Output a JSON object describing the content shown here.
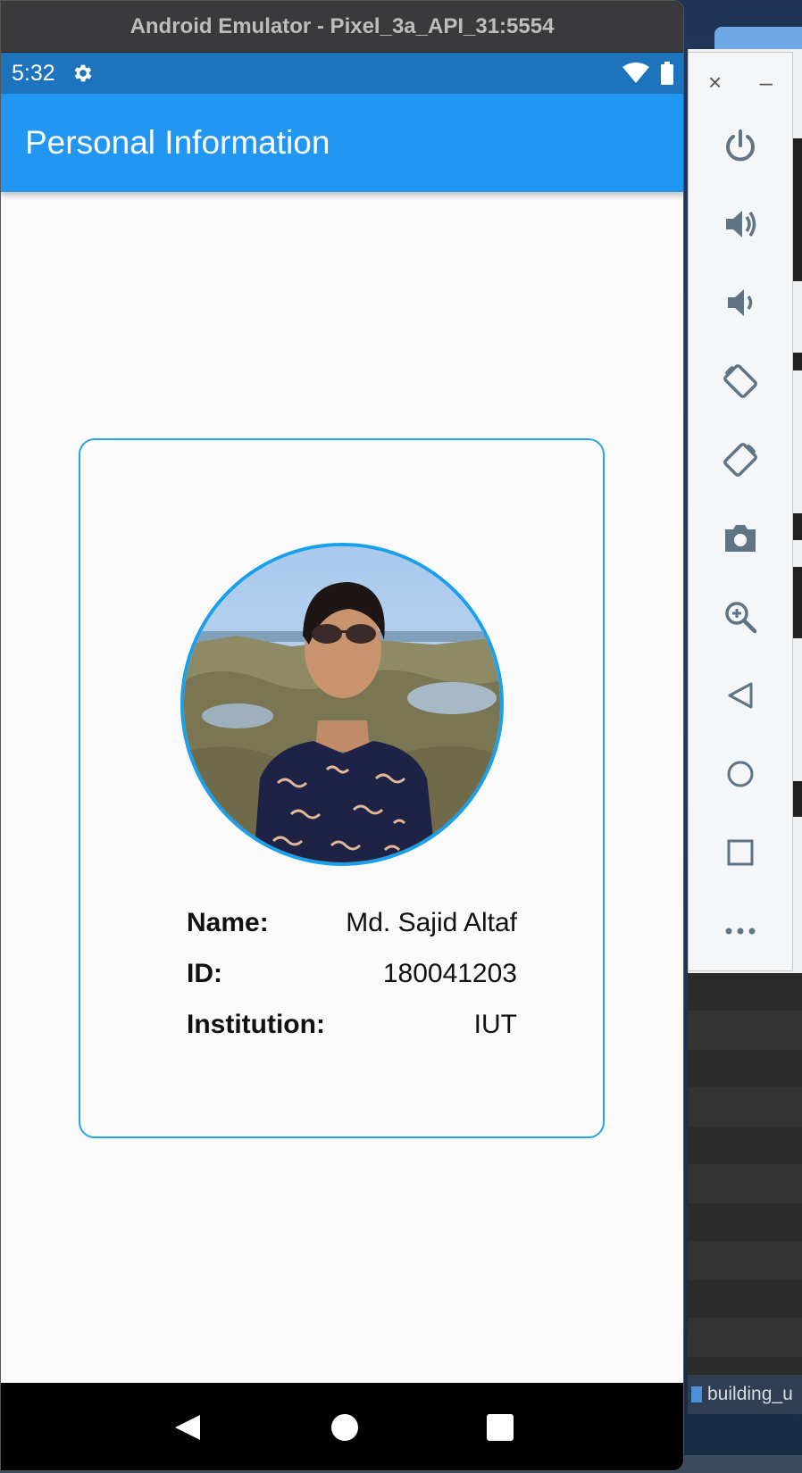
{
  "window": {
    "title": "Android Emulator - Pixel_3a_API_31:5554"
  },
  "status_bar": {
    "time": "5:32"
  },
  "app_bar": {
    "title": "Personal Information"
  },
  "profile": {
    "fields": [
      {
        "label": "Name:",
        "value": "Md. Sajid Altaf"
      },
      {
        "label": "ID:",
        "value": "180041203"
      },
      {
        "label": "Institution:",
        "value": "IUT"
      }
    ]
  },
  "side_panel": {
    "close_glyph": "×",
    "minimize_glyph": "–",
    "controls": [
      "power-icon",
      "volume-up-icon",
      "volume-down-icon",
      "rotate-left-icon",
      "rotate-right-icon",
      "camera-icon",
      "zoom-icon",
      "back-icon",
      "home-icon",
      "overview-icon",
      "more-icon"
    ]
  },
  "desktop": {
    "dock_label": "building_u"
  },
  "colors": {
    "app_bar": "#2196f3",
    "status_bar": "#1e73bd",
    "card_border": "#29a3e8",
    "side_icon": "#5f7584"
  }
}
